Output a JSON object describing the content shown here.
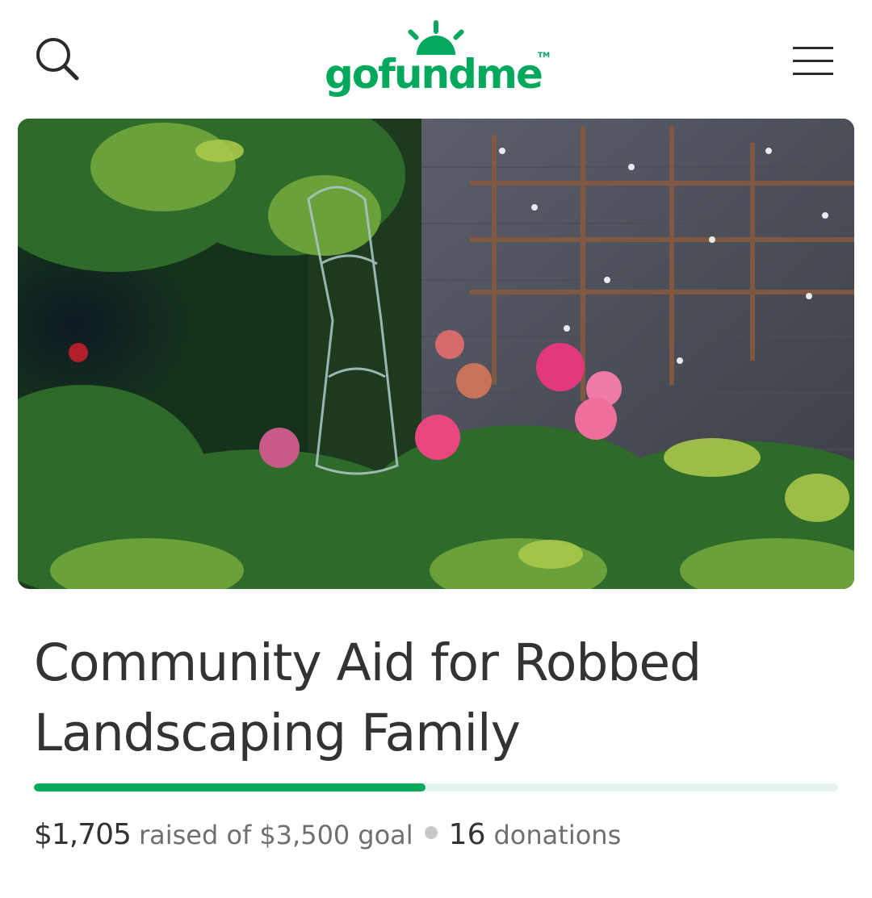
{
  "header": {
    "search_icon": "search-icon",
    "menu_icon": "hamburger-menu-icon",
    "logo_text": "gofundme",
    "logo_tm": "TM"
  },
  "colors": {
    "brand_green": "#02a95c",
    "progress_track": "#e5f5ee",
    "text_dark": "#333333",
    "text_muted": "#6f6f6f"
  },
  "campaign": {
    "title": "Community Aid for Robbed Landscaping Family",
    "raised": "$1,705",
    "raised_text": "raised of",
    "goal": "$3,500",
    "goal_text": "goal",
    "donations_count": "16",
    "donations_text": "donations",
    "progress": 0.487
  }
}
